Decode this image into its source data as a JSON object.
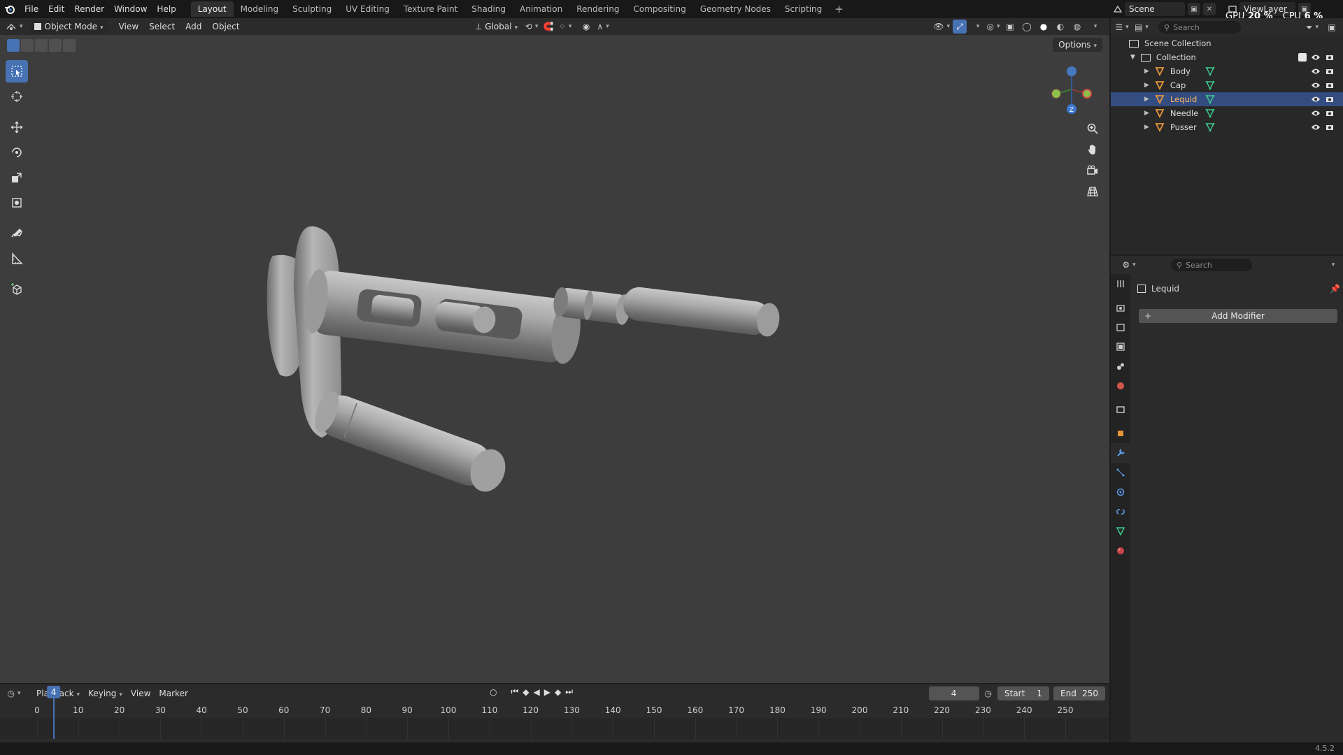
{
  "topbar": {
    "menus": [
      "File",
      "Edit",
      "Render",
      "Window",
      "Help"
    ],
    "workspaces": [
      "Layout",
      "Modeling",
      "Sculpting",
      "UV Editing",
      "Texture Paint",
      "Shading",
      "Animation",
      "Rendering",
      "Compositing",
      "Geometry Nodes",
      "Scripting"
    ],
    "add_workspace": "+",
    "scene": "Scene",
    "view_layer": "ViewLayer",
    "gpu_label": "GPU",
    "gpu_value": "20 %",
    "cpu_label": "CPU",
    "cpu_value": "6 %"
  },
  "viewport": {
    "mode": "Object Mode",
    "menus": [
      "View",
      "Select",
      "Add",
      "Object"
    ],
    "transform_orientation": "Global",
    "options": "Options",
    "gizmo_axis": "Z"
  },
  "timeline": {
    "menus": [
      "Playback",
      "Keying",
      "View",
      "Marker"
    ],
    "current_frame": "4",
    "start_label": "Start",
    "start_value": "1",
    "end_label": "End",
    "end_value": "250",
    "ticks": [
      "0",
      "10",
      "20",
      "30",
      "40",
      "50",
      "60",
      "70",
      "80",
      "90",
      "100",
      "110",
      "120",
      "130",
      "140",
      "150",
      "160",
      "170",
      "180",
      "190",
      "200",
      "210",
      "220",
      "230",
      "240",
      "250"
    ],
    "playhead": "4"
  },
  "outliner": {
    "search_placeholder": "Search",
    "scene_collection": "Scene Collection",
    "collection": "Collection",
    "objects": [
      "Body",
      "Cap",
      "Lequid",
      "Needle",
      "Pusser"
    ],
    "selected": "Lequid"
  },
  "properties": {
    "search_placeholder": "Search",
    "object_name": "Lequid",
    "add_modifier": "Add Modifier"
  },
  "status": {
    "version": "4.5.2"
  },
  "colors": {
    "accent": "#4772b3",
    "object_orange": "#e8953a",
    "mesh_green": "#3cc88c",
    "selection_row": "#334d80"
  }
}
